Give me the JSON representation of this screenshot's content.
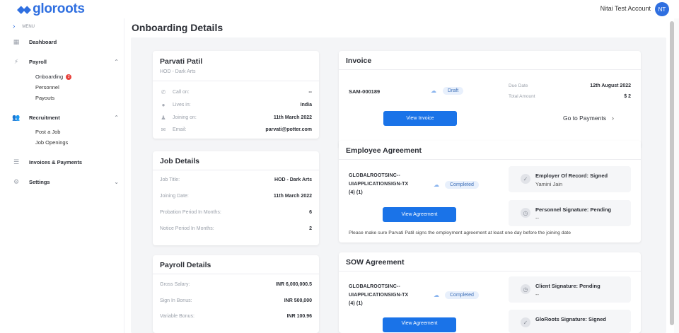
{
  "app": {
    "logo": "gloroots",
    "account_name": "Nitai Test Account",
    "avatar_initials": "NT",
    "accent": "#1a73e8"
  },
  "sidebar": {
    "menu_label": "MENU",
    "items": [
      {
        "label": "Dashboard",
        "icon": "dashboard-icon"
      },
      {
        "label": "Payroll",
        "icon": "payroll-icon",
        "subitems": [
          {
            "label": "Onboarding",
            "badge": "2"
          },
          {
            "label": "Personnel"
          },
          {
            "label": "Payouts"
          }
        ]
      },
      {
        "label": "Recruitment",
        "icon": "people-icon",
        "subitems": [
          {
            "label": "Post a Job"
          },
          {
            "label": "Job Openings"
          }
        ]
      },
      {
        "label": "Invoices & Payments",
        "icon": "list-icon"
      },
      {
        "label": "Settings",
        "icon": "gear-icon"
      }
    ]
  },
  "page": {
    "title": "Onboarding Details"
  },
  "profile": {
    "name": "Parvati Patil",
    "role": "HOD - Dark Arts",
    "rows": [
      {
        "label": "Call on:",
        "value": "--",
        "icon": "phone-icon"
      },
      {
        "label": "Lives in:",
        "value": "India",
        "icon": "location-icon"
      },
      {
        "label": "Joining on:",
        "value": "11th March 2022",
        "icon": "person-icon"
      },
      {
        "label": "Email:",
        "value": "parvati@potter.com",
        "icon": "mail-icon"
      }
    ]
  },
  "job_details": {
    "title": "Job Details",
    "rows": [
      {
        "label": "Job Title:",
        "value": "HOD - Dark Arts"
      },
      {
        "label": "Joining Date:",
        "value": "11th March 2022"
      },
      {
        "label": "Probation Period In Months:",
        "value": "6"
      },
      {
        "label": "Notice Period In Months:",
        "value": "2"
      }
    ]
  },
  "payroll_details": {
    "title": "Payroll Details",
    "rows": [
      {
        "label": "Gross Salary:",
        "value": "INR 6,000,000.5"
      },
      {
        "label": "Sign In Bonus:",
        "value": "INR 500,000"
      },
      {
        "label": "Variable Bonus:",
        "value": "INR 100.96"
      }
    ]
  },
  "invoice": {
    "title": "Invoice",
    "number": "SAM-000189",
    "status": "Draft",
    "due_date_label": "Due Date",
    "due_date": "12th August 2022",
    "total_label": "Total Amount",
    "total": "$ 2",
    "view_button": "View Invoice",
    "payments_link": "Go to Payments"
  },
  "employee_agreement": {
    "title": "Employee Agreement",
    "doc_lines": [
      "GLOBALROOTSINC--",
      "UIAPPLICATIONSIGN-TX",
      "(4) (1)"
    ],
    "status": "Completed",
    "view_button": "View Agreement",
    "signatures": [
      {
        "title": "Employer Of Record: Signed",
        "sub": "Yamini Jain",
        "icon": "check-icon"
      },
      {
        "title": "Personnel Signature: Pending",
        "sub": "--",
        "icon": "clock-icon"
      }
    ],
    "note": "Please make sure Parvati Patil signs the employment agreement at least one day before the joining date"
  },
  "sow_agreement": {
    "title": "SOW Agreement",
    "doc_lines": [
      "GLOBALROOTSINC--",
      "UIAPPLICATIONSIGN-TX",
      "(4) (1)"
    ],
    "status": "Completed",
    "view_button": "View Agreement",
    "signatures": [
      {
        "title": "Client Signature: Pending",
        "sub": "--",
        "icon": "clock-icon"
      },
      {
        "title": "GloRoots Signature: Signed",
        "sub": "",
        "icon": "check-icon"
      }
    ]
  }
}
